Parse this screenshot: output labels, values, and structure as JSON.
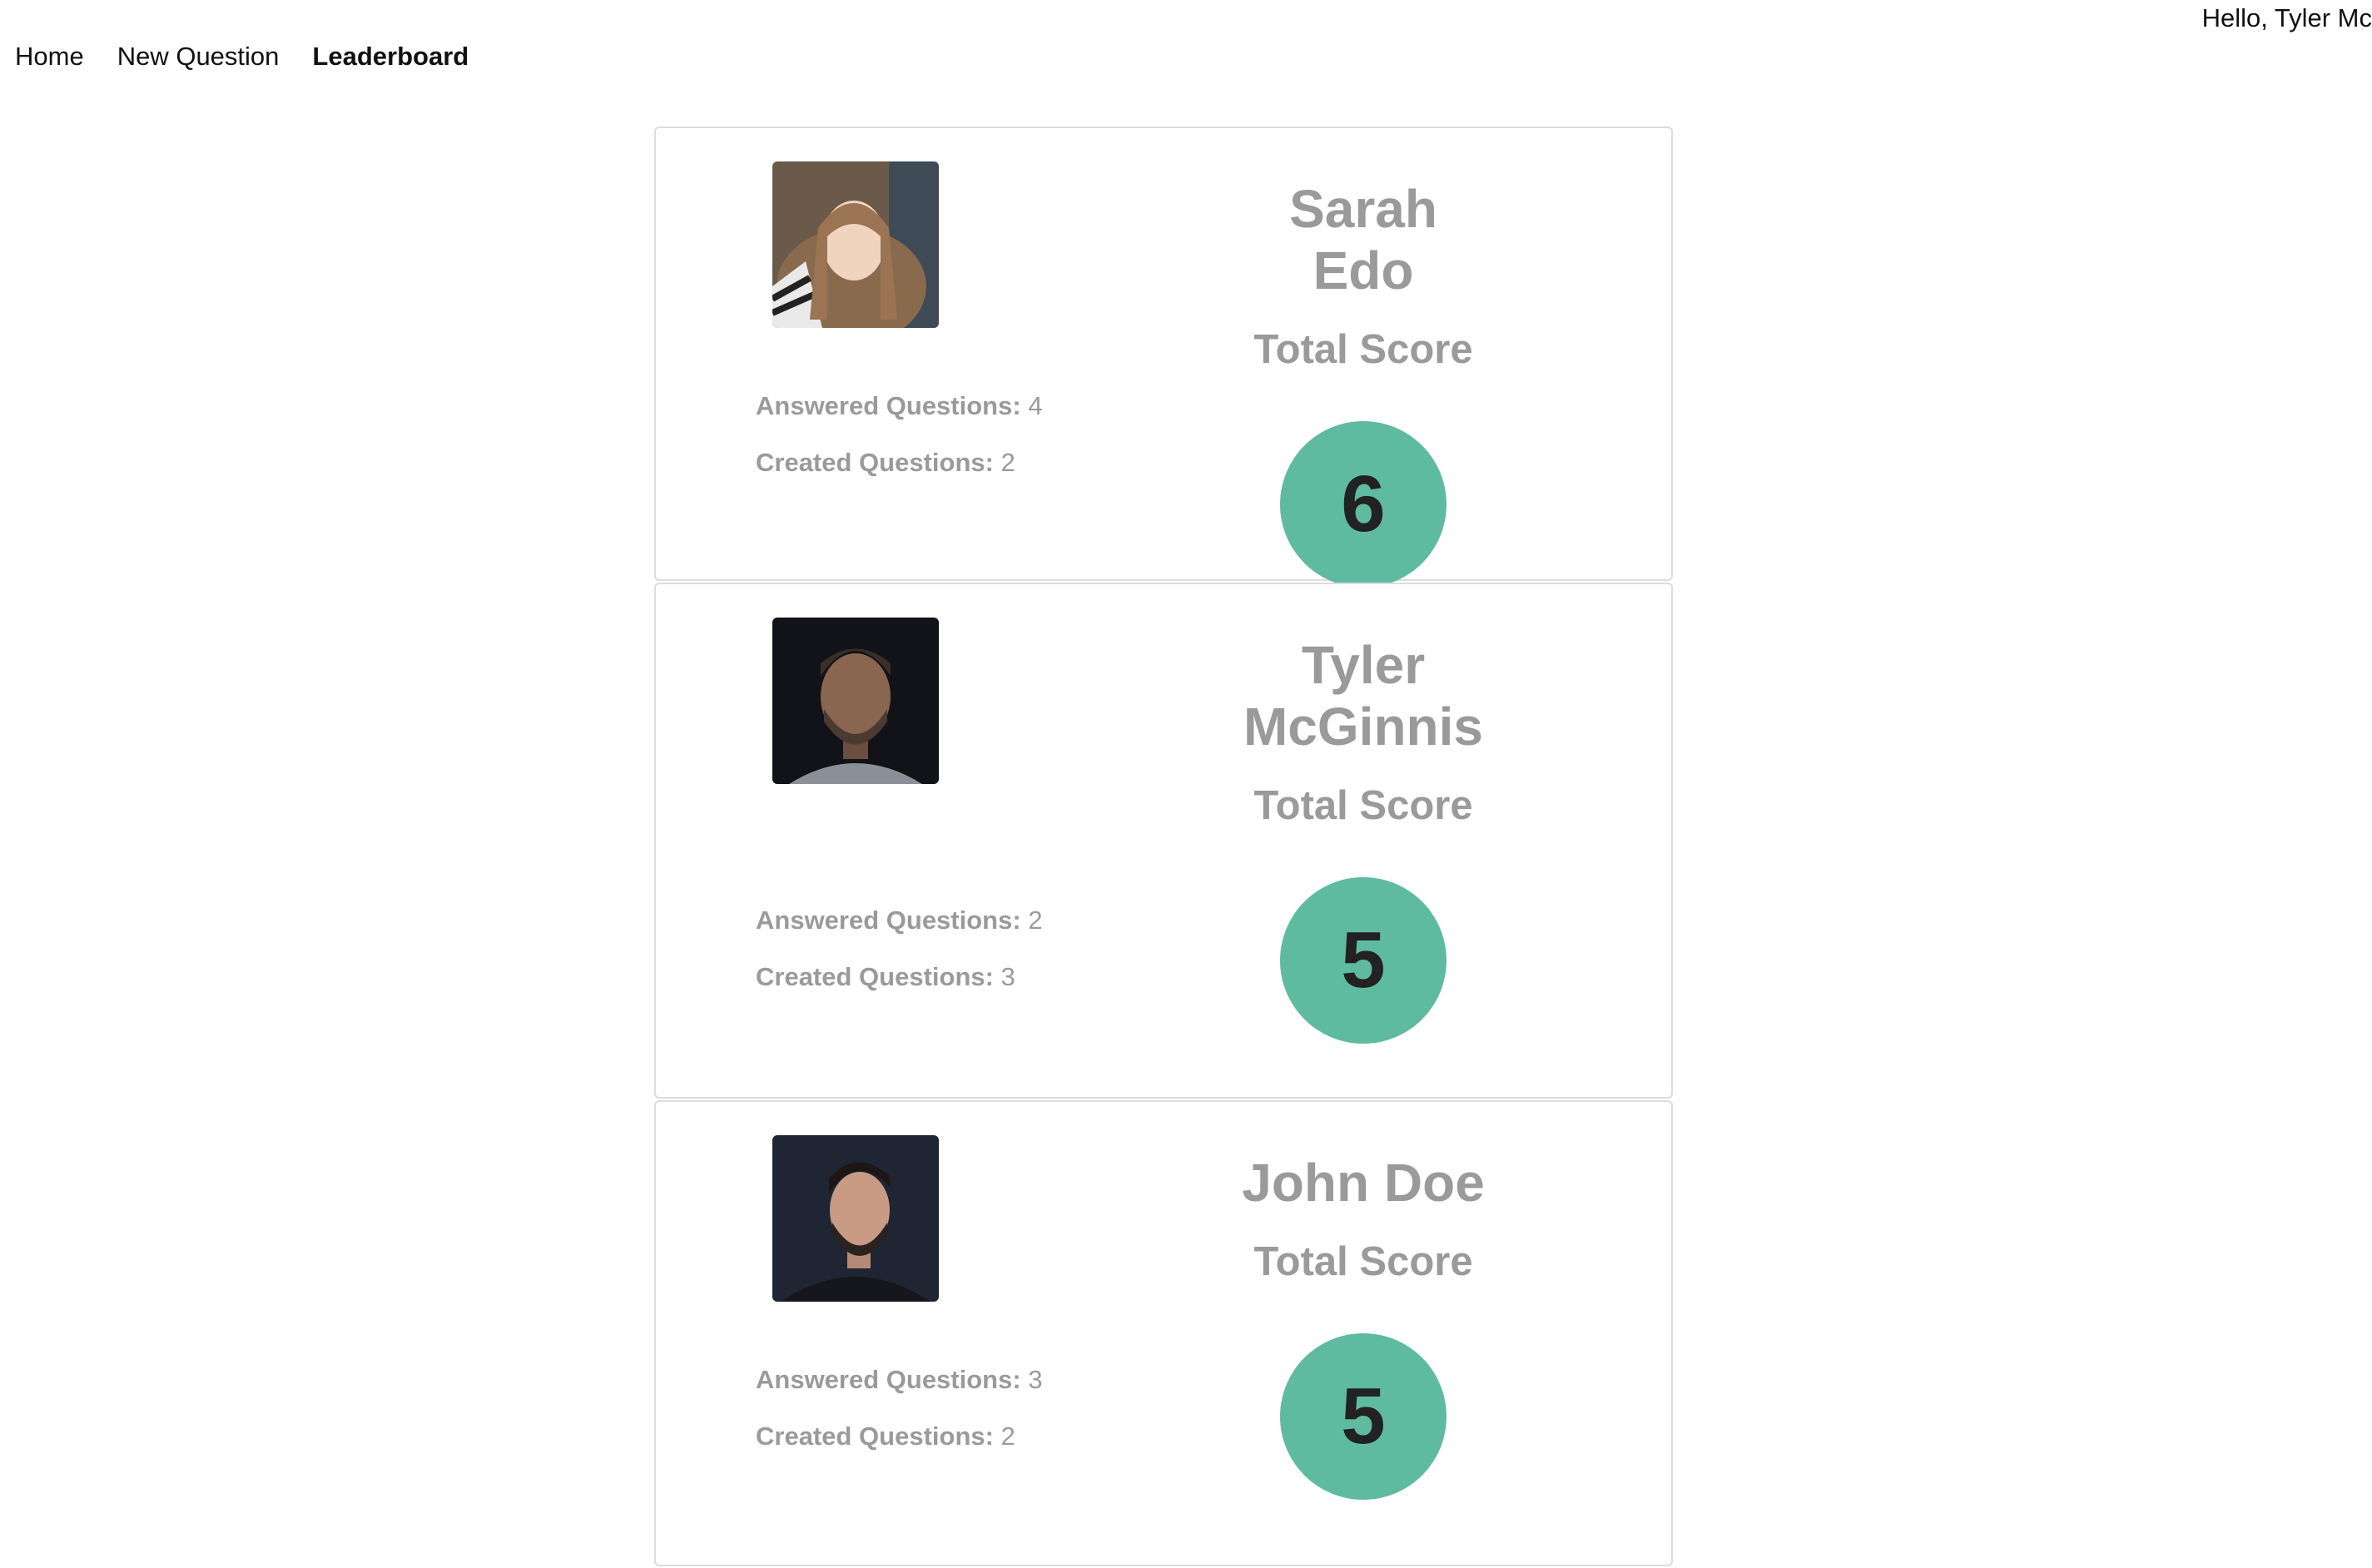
{
  "header": {
    "greeting": "Hello, Tyler Mc"
  },
  "nav": {
    "items": [
      "Home",
      "New Question",
      "Leaderboard"
    ],
    "active": "Leaderboard"
  },
  "leaderboard": {
    "stat_labels": {
      "answered": "Answered Questions:",
      "created": "Created Questions:"
    },
    "score_label": "Total Score",
    "colors": {
      "score_circle": "#5fbb9f",
      "muted_text": "#9a9a9a"
    },
    "users": [
      {
        "name": "Sarah Edo",
        "answered": "4",
        "created": "2",
        "score": "6"
      },
      {
        "name": "Tyler McGinnis",
        "answered": "2",
        "created": "3",
        "score": "5"
      },
      {
        "name": "John Doe",
        "answered": "3",
        "created": "2",
        "score": "5"
      }
    ]
  }
}
